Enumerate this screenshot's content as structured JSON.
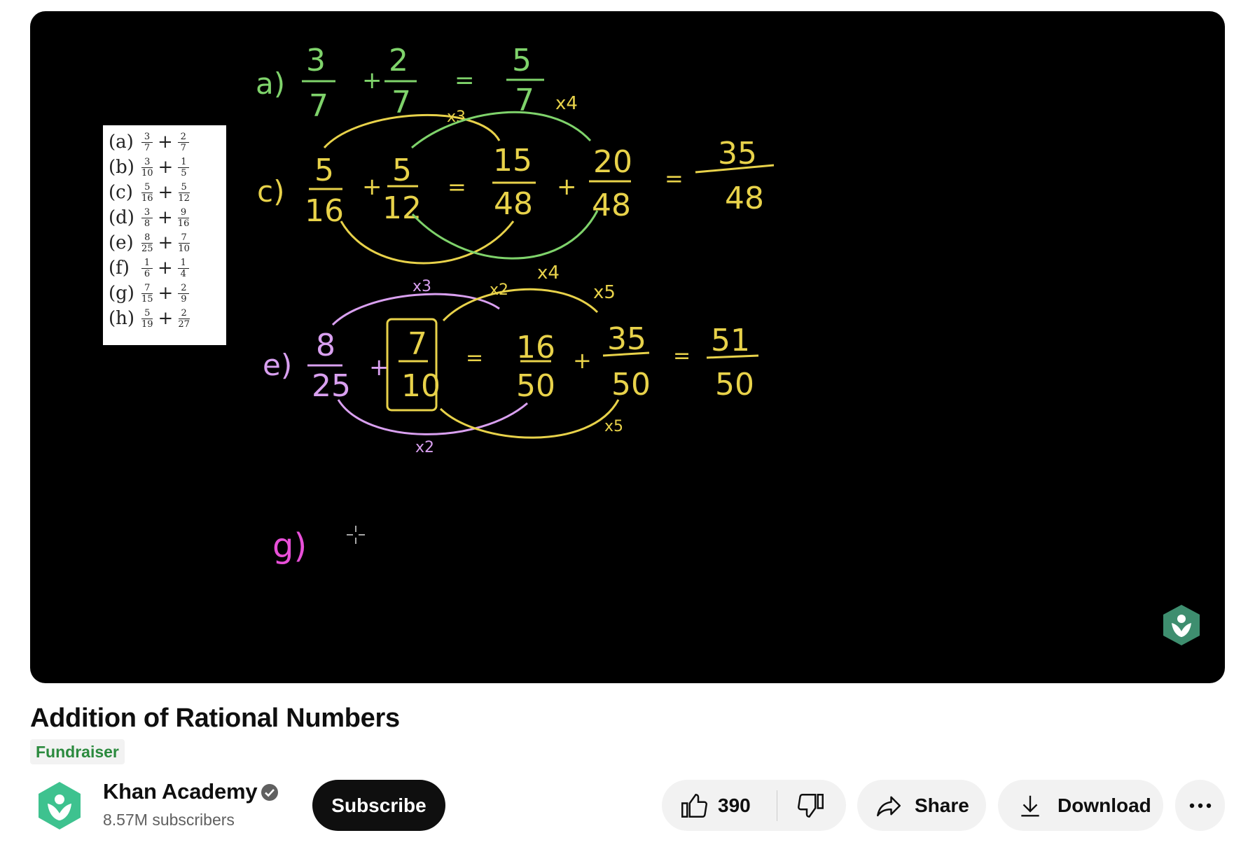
{
  "video": {
    "title": "Addition of Rational Numbers",
    "badge": "Fundraiser"
  },
  "problems": [
    {
      "label": "(a)",
      "a": [
        "3",
        "7"
      ],
      "b": [
        "2",
        "7"
      ]
    },
    {
      "label": "(b)",
      "a": [
        "3",
        "10"
      ],
      "b": [
        "1",
        "5"
      ]
    },
    {
      "label": "(c)",
      "a": [
        "5",
        "16"
      ],
      "b": [
        "5",
        "12"
      ]
    },
    {
      "label": "(d)",
      "a": [
        "3",
        "8"
      ],
      "b": [
        "9",
        "16"
      ]
    },
    {
      "label": "(e)",
      "a": [
        "8",
        "25"
      ],
      "b": [
        "7",
        "10"
      ]
    },
    {
      "label": "(f)",
      "a": [
        "1",
        "6"
      ],
      "b": [
        "1",
        "4"
      ]
    },
    {
      "label": "(g)",
      "a": [
        "7",
        "15"
      ],
      "b": [
        "2",
        "9"
      ]
    },
    {
      "label": "(h)",
      "a": [
        "5",
        "19"
      ],
      "b": [
        "2",
        "27"
      ]
    }
  ],
  "board": {
    "a": {
      "label": "a)",
      "terms": [
        [
          "3",
          "7"
        ],
        [
          "2",
          "7"
        ],
        [
          "5",
          "7"
        ]
      ]
    },
    "c": {
      "label": "c)",
      "terms": [
        [
          "5",
          "16"
        ],
        [
          "5",
          "12"
        ],
        [
          "15",
          "48"
        ],
        [
          "20",
          "48"
        ],
        [
          "35",
          "48"
        ]
      ],
      "multipliers": [
        "x3",
        "x4"
      ]
    },
    "e": {
      "label": "e)",
      "terms": [
        [
          "8",
          "25"
        ],
        [
          "7",
          "10"
        ],
        [
          "16",
          "50"
        ],
        [
          "35",
          "50"
        ],
        [
          "51",
          "50"
        ]
      ],
      "multipliers": [
        "x3",
        "x2",
        "x4",
        "x5",
        "x2",
        "x5"
      ]
    },
    "g": {
      "label": "g)"
    }
  },
  "channel": {
    "name": "Khan Academy",
    "subscribers": "8.57M subscribers",
    "subscribe_label": "Subscribe"
  },
  "actions": {
    "likes": "390",
    "share_label": "Share",
    "download_label": "Download"
  },
  "icons": {
    "like": "thumbs-up-icon",
    "dislike": "thumbs-down-icon",
    "share": "share-arrow-icon",
    "download": "download-icon",
    "more": "more-horizontal-icon",
    "verified": "verified-check-icon",
    "logo": "khan-academy-logo-icon"
  },
  "colors": {
    "green": "#7fd36b",
    "yellow": "#e8d24a",
    "purple": "#d9a0f0",
    "magenta": "#e84fd8",
    "ka_teal": "#3ec28f"
  }
}
